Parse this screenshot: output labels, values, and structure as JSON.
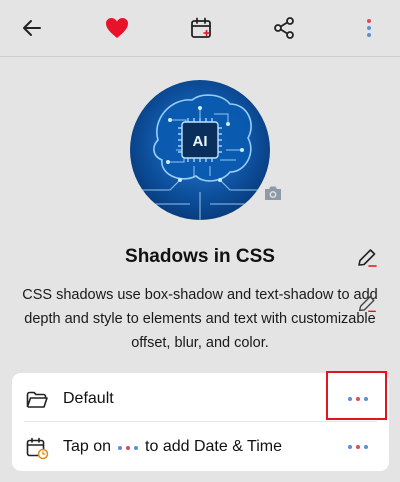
{
  "toolbar": {
    "back_icon": "arrow-left-icon",
    "favorite_icon": "heart-icon",
    "calendar_icon": "calendar-add-icon",
    "share_icon": "share-icon",
    "menu_icon": "vertical-dots-icon",
    "favorite_color": "#e8122a"
  },
  "note": {
    "image_text": "AI",
    "title": "Shadows in CSS",
    "description": "CSS shadows use box-shadow and text-shadow to add depth and style to elements and text with customizable offset, blur, and color."
  },
  "details": {
    "folder_label": "Default",
    "reminder_prefix": "Tap on",
    "reminder_suffix": "to add Date & Time"
  },
  "colors": {
    "accent_red": "#e5121f",
    "dot_blue": "#5b8fd6",
    "dot_red": "#d94a5a"
  }
}
